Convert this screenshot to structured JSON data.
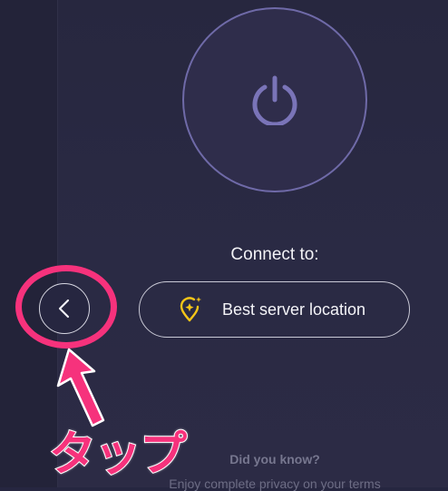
{
  "connect": {
    "label": "Connect to:",
    "server_button_label": "Best server location"
  },
  "annotation": {
    "tap_text": "タップ",
    "color": "#f6327c"
  },
  "tips": {
    "heading": "Did you know?",
    "text": "Enjoy complete privacy on your terms"
  },
  "icons": {
    "power": "power-icon",
    "location_pin": "location-pin-sparkle-icon",
    "back": "chevron-left-icon"
  },
  "colors": {
    "background": "#262640",
    "ring": "#6f6aa8",
    "pin": "#f5c518",
    "highlight": "#f6327c"
  }
}
